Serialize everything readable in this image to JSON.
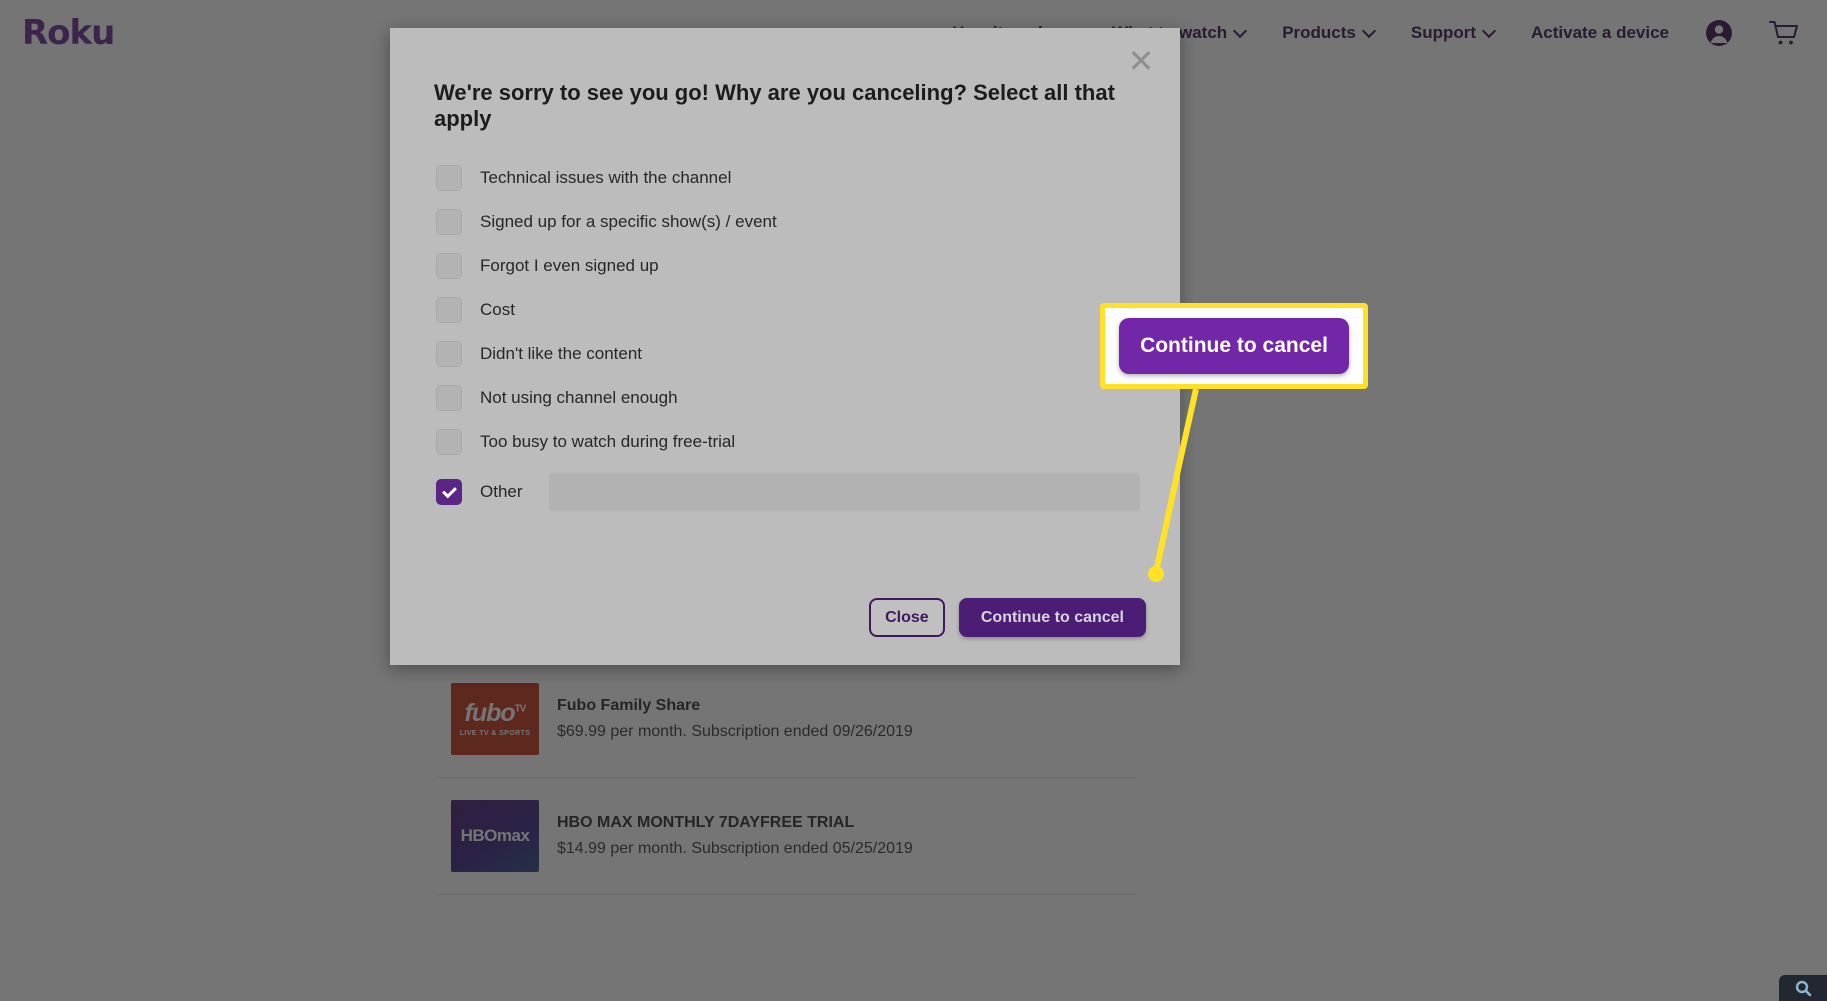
{
  "header": {
    "logo_text": "Roku",
    "nav_items": [
      {
        "label": "How it works",
        "has_chevron": true
      },
      {
        "label": "What to watch",
        "has_chevron": true
      },
      {
        "label": "Products",
        "has_chevron": true
      },
      {
        "label": "Support",
        "has_chevron": true
      },
      {
        "label": "Activate a device",
        "has_chevron": false
      }
    ],
    "account_icon": "account-icon",
    "cart_icon": "cart-icon"
  },
  "modal": {
    "close_icon": "close-icon",
    "title": "We're sorry to see you go! Why are you canceling? Select all that apply",
    "options": [
      {
        "label": "Technical issues with the channel",
        "checked": false
      },
      {
        "label": "Signed up for a specific show(s) / event",
        "checked": false
      },
      {
        "label": "Forgot I even signed up",
        "checked": false
      },
      {
        "label": "Cost",
        "checked": false
      },
      {
        "label": "Didn't like the content",
        "checked": false
      },
      {
        "label": "Not using channel enough",
        "checked": false
      },
      {
        "label": "Too busy to watch during free-trial",
        "checked": false
      }
    ],
    "other": {
      "label": "Other",
      "checked": true,
      "input_value": "",
      "input_placeholder": ""
    },
    "buttons": {
      "close": "Close",
      "continue": "Continue to cancel"
    }
  },
  "annotation": {
    "callout_button_label": "Continue to cancel",
    "highlight_color": "#ffe226",
    "button_color": "#7127a8"
  },
  "subscriptions": [
    {
      "logo_name": "fubo-tv-logo",
      "logo_primary": "fubo",
      "logo_sup": "TV",
      "logo_secondary": "LIVE TV & SPORTS",
      "title": "Fubo Family Share",
      "meta": "$69.99 per month. Subscription ended 09/26/2019"
    },
    {
      "logo_name": "hbo-max-logo",
      "logo_primary": "HBOmax",
      "logo_sup": "",
      "logo_secondary": "",
      "title": "HBO MAX MONTHLY 7DAYFREE TRIAL",
      "meta": "$14.99 per month. Subscription ended 05/25/2019"
    }
  ],
  "corner_widget": {
    "icon": "search-widget-icon"
  }
}
